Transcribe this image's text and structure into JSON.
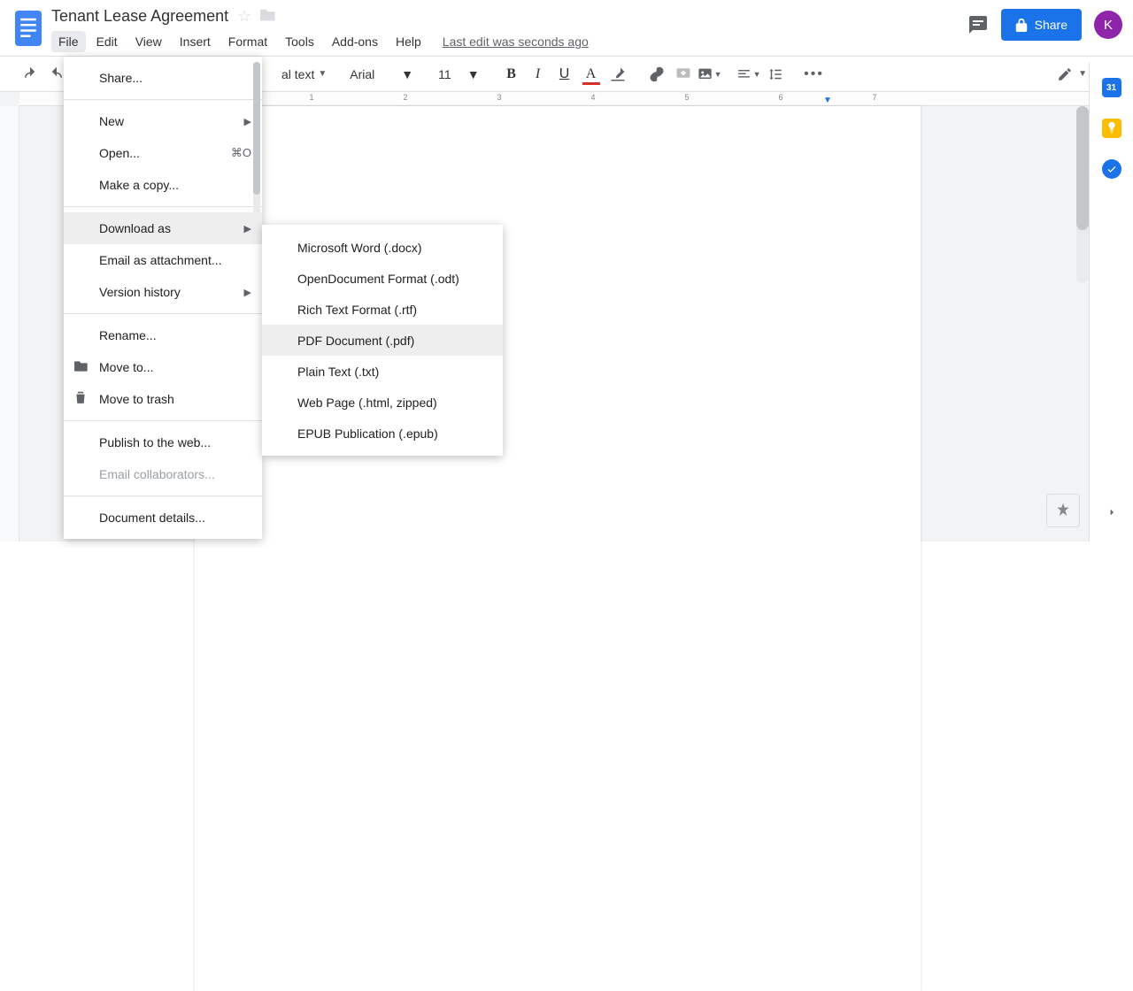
{
  "header": {
    "doc_title": "Tenant Lease Agreement",
    "menus": [
      "File",
      "Edit",
      "View",
      "Insert",
      "Format",
      "Tools",
      "Add-ons",
      "Help"
    ],
    "active_menu_index": 0,
    "last_edit": "Last edit was seconds ago",
    "share_label": "Share",
    "avatar_initial": "K"
  },
  "toolbar": {
    "style": "Normal text",
    "style_visible": "al text",
    "font": "Arial",
    "size": "11"
  },
  "side_panel": {
    "cal_day": "31"
  },
  "file_menu": {
    "items": [
      {
        "label": "Share...",
        "type": "item"
      },
      {
        "type": "sep"
      },
      {
        "label": "New",
        "type": "submenu"
      },
      {
        "label": "Open...",
        "type": "item",
        "shortcut": "⌘O"
      },
      {
        "label": "Make a copy...",
        "type": "item"
      },
      {
        "type": "sep"
      },
      {
        "label": "Download as",
        "type": "submenu",
        "highlighted": true
      },
      {
        "label": "Email as attachment...",
        "type": "item"
      },
      {
        "label": "Version history",
        "type": "submenu"
      },
      {
        "type": "sep"
      },
      {
        "label": "Rename...",
        "type": "item"
      },
      {
        "label": "Move to...",
        "type": "item",
        "icon": "folder"
      },
      {
        "label": "Move to trash",
        "type": "item",
        "icon": "trash"
      },
      {
        "type": "sep"
      },
      {
        "label": "Publish to the web...",
        "type": "item"
      },
      {
        "label": "Email collaborators...",
        "type": "item",
        "disabled": true
      },
      {
        "type": "sep"
      },
      {
        "label": "Document details...",
        "type": "item"
      }
    ]
  },
  "download_submenu": {
    "items": [
      {
        "label": "Microsoft Word (.docx)"
      },
      {
        "label": "OpenDocument Format (.odt)"
      },
      {
        "label": "Rich Text Format (.rtf)"
      },
      {
        "label": "PDF Document (.pdf)",
        "highlighted": true
      },
      {
        "label": "Plain Text (.txt)"
      },
      {
        "label": "Web Page (.html, zipped)"
      },
      {
        "label": "EPUB Publication (.epub)"
      }
    ]
  },
  "ruler_h": [
    "1",
    "2",
    "3",
    "4",
    "5",
    "6",
    "7"
  ]
}
